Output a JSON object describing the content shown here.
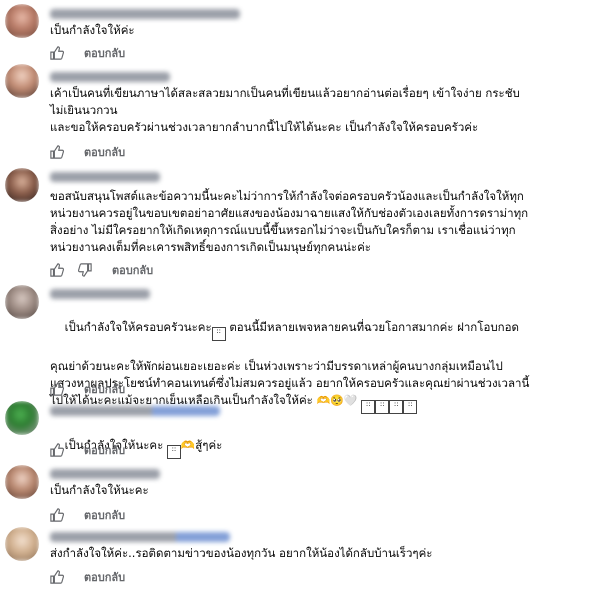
{
  "actions": {
    "reply_label": "ตอบกลับ"
  },
  "comments": [
    {
      "text": "เป็นกำลังใจให้ค่ะ"
    },
    {
      "text": "เค้าเป็นคนที่เขียนภาษาได้สละสลวยมากเป็นคนที่เขียนแล้วอยากอ่านต่อเรื่อยๆ เข้าใจง่าย กระชับ\nไม่เยินนวกวน\nและขอให้ครอบครัวผ่านช่วงเวลายากลำบากนี้ไปให้ได้นะคะ เป็นกำลังใจให้ครอบครัวค่ะ"
    },
    {
      "text": "ขอสนับสนุนโพสต์และข้อความนี้นะคะไม่ว่าการให้กำลังใจต่อครอบครัวน้องและเป็นกำลังใจให้ทุก\nหน่วยงานควรอยู่ในขอบเขตอย่าอาศัยแสงของน้องมาฉายแสงให้กับช่องตัวเองเลยทั้งการดราม่าทุก\nสิ่งอย่าง ไม่มีใครอยากให้เกิดเหตุการณ์แบบนี้ขึ้นหรอกไม่ว่าจะเป็นกับใครก็ตาม เราเชื่อแน่ว่าทุก\nหน่วยงานคงเต็มที่คะเคารพสิทธิ์ของการเกิดเป็นมนุษย์ทุกคนน่ะค่ะ"
    },
    {
      "line1": "เป็นกำลังใจให้ครอบครัวนะคะ",
      "line1b": " ตอนนี้มีหลายเพจหลายคนที่ฉวยโอกาสมากค่ะ ฝากโอบกอด",
      "text": "คุณย่าด้วยนะคะให้พักผ่อนเยอะเยอะค่ะ เป็นห่วงเพราะว่ามีบรรดาเหล่าผู้คนบางกลุ่มเหมือนไป\nแสวงหาผลประโยชน์ทำคอนเทนต์ซึ่งไม่สมควรอยู่แล้ว อยากให้ครอบครัวและคุณย่าผ่านช่วงเวลานี้\nไปให้ได้นะคะแม้จะยากเย็นเหลือเกินเป็นกำลังใจให้ค่ะ"
    },
    {
      "text": "เป็นกำลังใจให้นะคะ",
      "suffix": "สู้ๆค่ะ"
    },
    {
      "text": "เป็นกำลังใจให้นะคะ"
    },
    {
      "text": "ส่งกำลังใจให้ค่ะ..รอติดตามข่าวของน้องทุกวัน อยากให้น้องได้กลับบ้านเร็วๆค่ะ"
    }
  ]
}
